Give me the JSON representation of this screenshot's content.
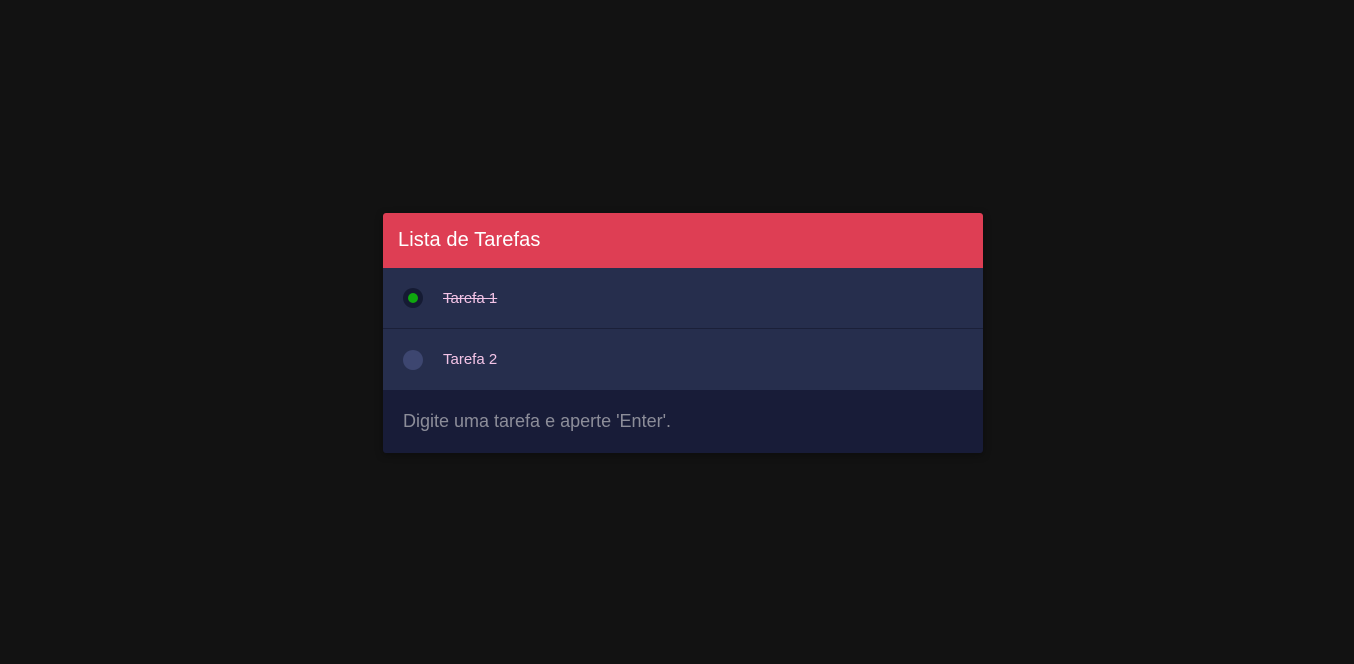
{
  "header": {
    "title": "Lista de Tarefas"
  },
  "tasks": [
    {
      "label": "Tarefa 1",
      "done": true
    },
    {
      "label": "Tarefa 2",
      "done": false
    }
  ],
  "input": {
    "value": "",
    "placeholder": "Digite uma tarefa e aperte 'Enter'."
  },
  "colors": {
    "background": "#121212",
    "header": "#de3e54",
    "list_bg": "#262e4d",
    "input_bg": "#181c38",
    "done_indicator": "#0fa80f",
    "task_text": "#f2c3e6"
  }
}
